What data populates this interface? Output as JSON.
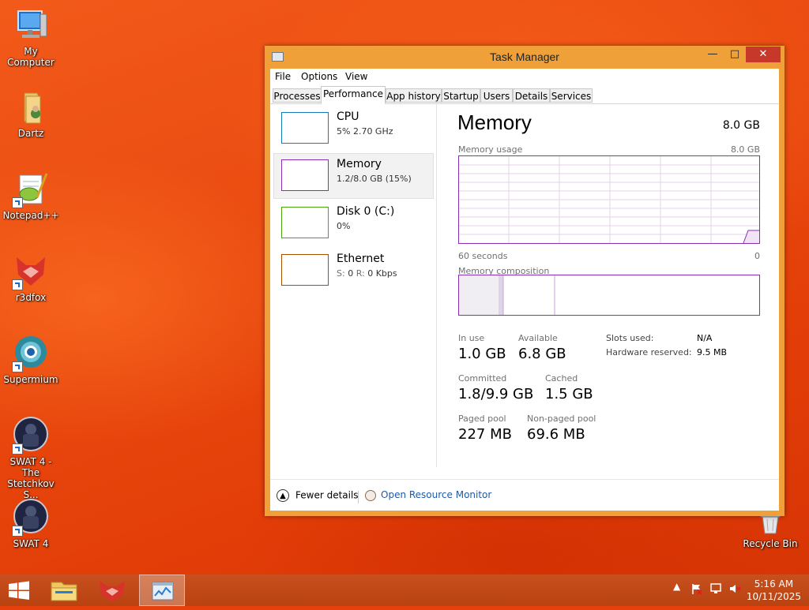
{
  "desktop": {
    "icons": [
      {
        "label": "My Computer",
        "icon": "computer-icon"
      },
      {
        "label": "Dartz",
        "icon": "folder-icon"
      },
      {
        "label": "Notepad++",
        "icon": "notepadpp-icon"
      },
      {
        "label": "r3dfox",
        "icon": "r3dfox-icon"
      },
      {
        "label": "Supermium",
        "icon": "supermium-icon"
      },
      {
        "label": "SWAT 4 - The Stetchkov S...",
        "icon": "swat4-tsk-icon"
      },
      {
        "label": "SWAT 4",
        "icon": "swat4-icon"
      },
      {
        "label": "Recycle Bin",
        "icon": "recycle-bin-icon"
      }
    ]
  },
  "window": {
    "title": "Task Manager",
    "minimize": "—",
    "maximize": "□",
    "close": "✕",
    "colors": {
      "frame": "#f0a038",
      "memory": "#8b2eb6",
      "cpu": "#117dbb",
      "disk": "#4da60c",
      "ethernet": "#a74f01"
    }
  },
  "menu": {
    "file": "File",
    "options": "Options",
    "view": "View"
  },
  "tabs": [
    "Processes",
    "Performance",
    "App history",
    "Startup",
    "Users",
    "Details",
    "Services"
  ],
  "active_tab": "Performance",
  "resources": [
    {
      "name": "CPU",
      "sub": "5%  2.70 GHz"
    },
    {
      "name": "Memory",
      "sub": "1.2/8.0 GB (15%)"
    },
    {
      "name": "Disk 0 (C:)",
      "sub": "0%"
    },
    {
      "name": "Ethernet",
      "sub_prefix": "S:",
      "sub_s": "0",
      "sub_r_label": "R:",
      "sub_r": "0 Kbps"
    }
  ],
  "memory": {
    "title": "Memory",
    "total": "8.0 GB",
    "usage_label": "Memory usage",
    "usage_max": "8.0 GB",
    "time_left": "60 seconds",
    "time_right": "0",
    "composition_label": "Memory composition",
    "stats": {
      "in_use_label": "In use",
      "in_use": "1.0 GB",
      "available_label": "Available",
      "available": "6.8 GB",
      "committed_label": "Committed",
      "committed": "1.8/9.9 GB",
      "cached_label": "Cached",
      "cached": "1.5 GB",
      "paged_label": "Paged pool",
      "paged": "227 MB",
      "nonpaged_label": "Non-paged pool",
      "nonpaged": "69.6 MB",
      "slots_label": "Slots used:",
      "slots": "N/A",
      "reserved_label": "Hardware reserved:",
      "reserved": "9.5 MB"
    }
  },
  "footer": {
    "fewer": "Fewer details",
    "orm": "Open Resource Monitor"
  },
  "taskbar": {
    "time": "5:16 AM",
    "date": "10/11/2025",
    "apps": [
      "start-icon",
      "file-explorer-icon",
      "r3dfox-icon",
      "task-manager-icon"
    ]
  }
}
